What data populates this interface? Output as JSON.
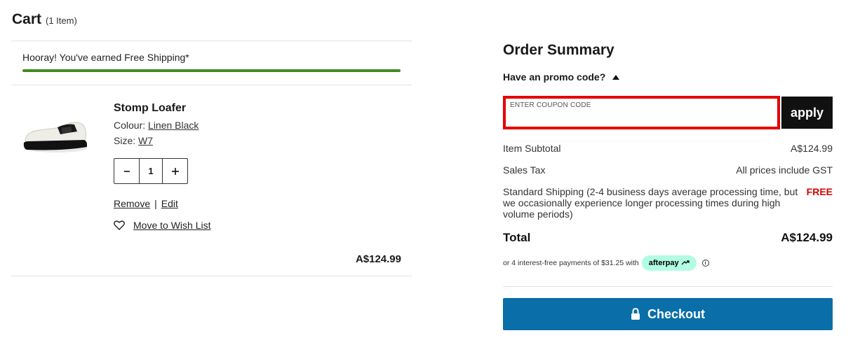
{
  "cart": {
    "title": "Cart",
    "count": "(1 Item)",
    "free_shipping_message": "Hooray! You've earned Free Shipping*",
    "free_shipping_progress": 1.0,
    "item": {
      "name": "Stomp Loafer",
      "colour_label": "Colour:",
      "colour_value": "Linen Black",
      "size_label": "Size:",
      "size_value": "W7",
      "quantity": "1",
      "decrement": "-",
      "increment": "+",
      "remove_label": "Remove",
      "separator": "|",
      "edit_label": "Edit",
      "wishlist_label": "Move to Wish List",
      "price": "A$124.99"
    }
  },
  "summary": {
    "title": "Order Summary",
    "promo_toggle": "Have an promo code?",
    "coupon_label": "ENTER COUPON CODE",
    "coupon_value": "",
    "apply_label": "apply",
    "subtotal_label": "Item Subtotal",
    "subtotal_value": "A$124.99",
    "tax_label": "Sales Tax",
    "tax_value": "All prices include GST",
    "shipping_label": "Standard Shipping (2-4 business days average processing time, but we occasionally experience longer processing times during high volume periods)",
    "shipping_value": "FREE",
    "total_label": "Total",
    "total_value": "A$124.99",
    "afterpay_text": "or 4 interest-free payments of $31.25 with",
    "afterpay_brand": "afterpay",
    "checkout_label": "Checkout"
  },
  "colors": {
    "progress": "#3f8a24",
    "checkout": "#0a6ea8",
    "highlight": "#e60000",
    "free": "#d40000",
    "afterpay_badge": "#b2fce4"
  },
  "icons": [
    "minus-icon",
    "plus-icon",
    "heart-icon",
    "caret-up-icon",
    "lock-icon",
    "afterpay-arrows-icon",
    "info-icon"
  ]
}
